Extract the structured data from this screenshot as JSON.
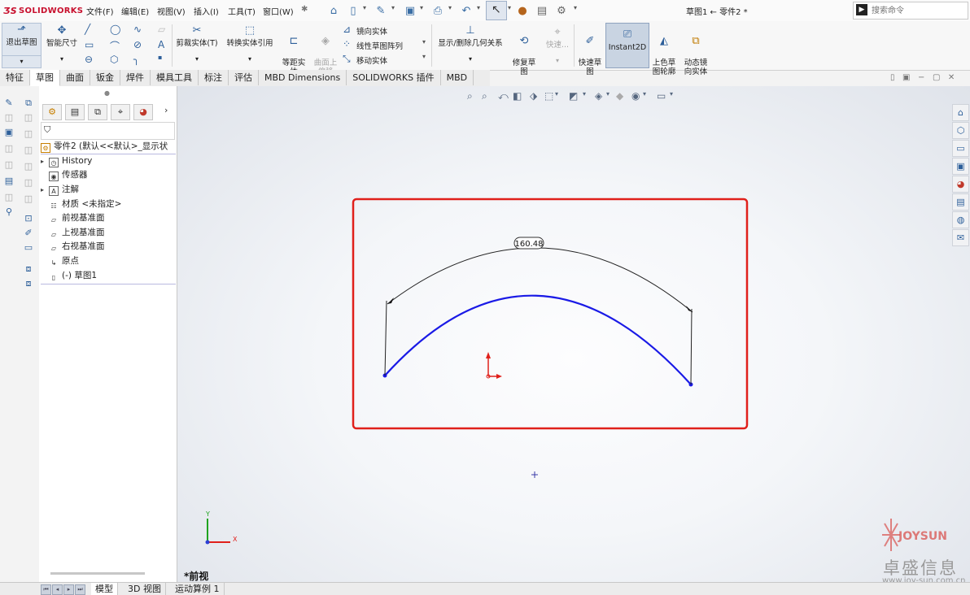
{
  "app": {
    "logo_text": "SOLIDWORKS",
    "doc_title": "草图1 ← 零件2 *"
  },
  "menu": [
    "文件(F)",
    "编辑(E)",
    "视图(V)",
    "插入(I)",
    "工具(T)",
    "窗口(W)"
  ],
  "search": {
    "placeholder": "搜索命令"
  },
  "ribbon": {
    "exit_sketch": "退出草图",
    "smart_dim": "智能尺寸",
    "trim": "剪裁实体(T)",
    "convert": "转换实体引用",
    "offset": "等距实\n体",
    "surface_offset": "曲面上\n偏移",
    "mirror": "镜向实体",
    "linear_pattern": "线性草图阵列",
    "move": "移动实体",
    "display_delete": "显示/删除几何关系",
    "repair": "修复草\n图",
    "quick_snaps": "快速...",
    "rapid_sketch": "快速草\n图",
    "instant2d": "Instant2D",
    "shaded_contours": "上色草\n图轮廓",
    "dynamic_mirror": "动态镜\n向实体"
  },
  "tabs": [
    "特征",
    "草图",
    "曲面",
    "钣金",
    "焊件",
    "模具工具",
    "标注",
    "评估",
    "MBD Dimensions",
    "SOLIDWORKS 插件",
    "MBD"
  ],
  "active_tab": "草图",
  "feature_tree": {
    "root": "零件2 (默认<<默认>_显示状",
    "items": [
      "History",
      "传感器",
      "注解",
      "材质 <未指定>",
      "前视基准面",
      "上视基准面",
      "右视基准面",
      "原点",
      "(-) 草图1"
    ]
  },
  "viewport": {
    "dimension": "160.48",
    "view_label": "*前视",
    "axis_y": "Y",
    "axis_x": "X",
    "highlight_color": "#e0201b",
    "arc_color": "#1a1ae6"
  },
  "bottom_tabs": [
    "模型",
    "3D 视图",
    "运动算例 1"
  ],
  "watermark": {
    "brand": "JOYSUN",
    "cn": "卓盛信息",
    "url": "www.joy-sun.com.cn"
  }
}
